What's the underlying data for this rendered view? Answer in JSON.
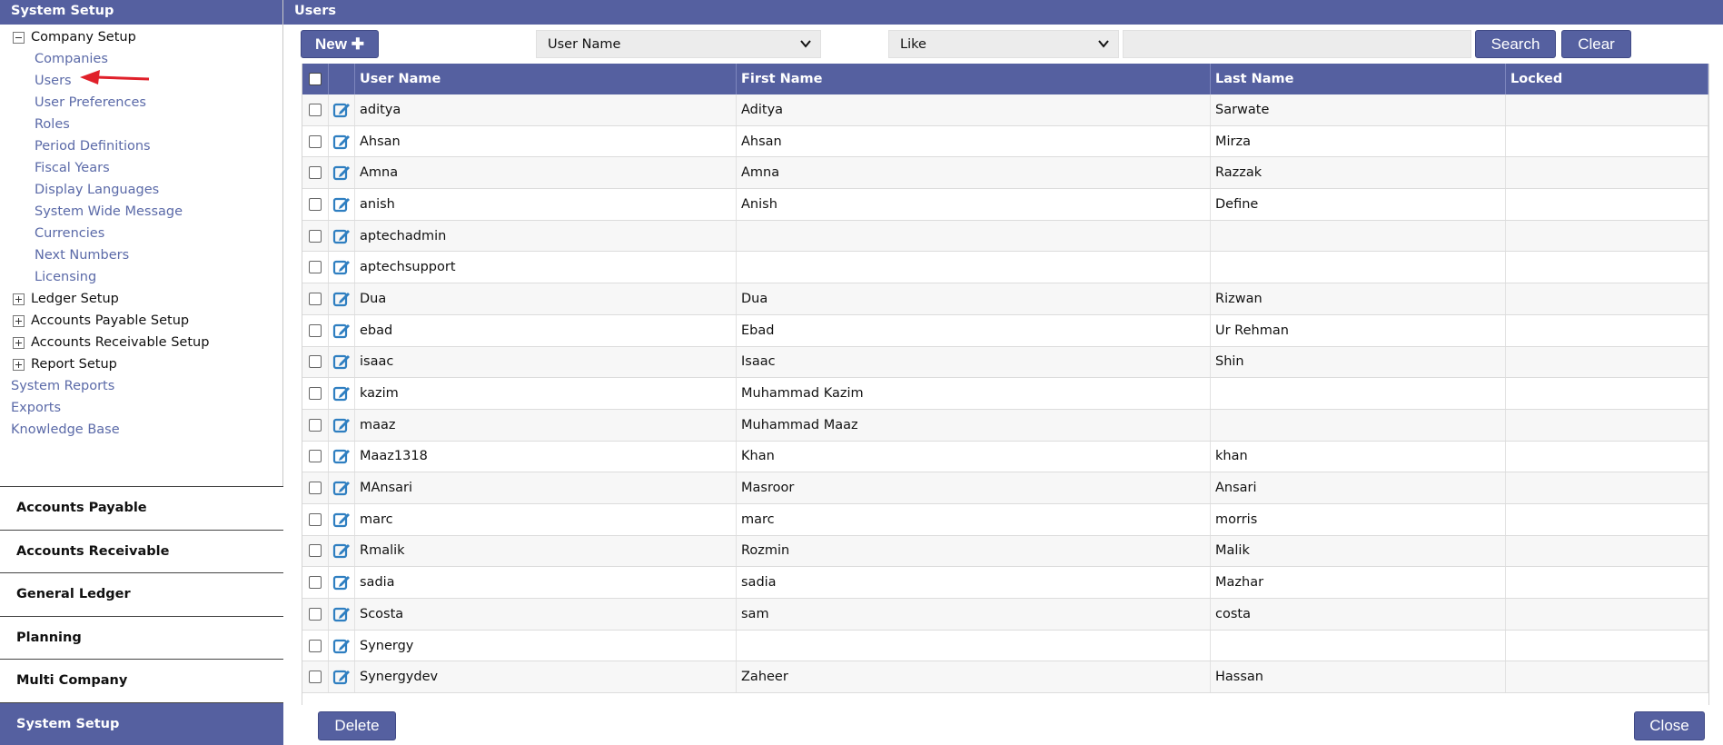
{
  "sidebar": {
    "title": "System Setup",
    "company_setup_label": "Company Setup",
    "company_setup_children": [
      "Companies",
      "Users",
      "User Preferences",
      "Roles",
      "Period Definitions",
      "Fiscal Years",
      "Display Languages",
      "System Wide Message",
      "Currencies",
      "Next Numbers",
      "Licensing"
    ],
    "collapsed_sections": [
      "Ledger Setup",
      "Accounts Payable Setup",
      "Accounts Receivable Setup",
      "Report Setup"
    ],
    "plain_links": [
      "System Reports",
      "Exports",
      "Knowledge Base"
    ],
    "modules": [
      "Accounts Payable",
      "Accounts Receivable",
      "General Ledger",
      "Planning",
      "Multi Company",
      "System Setup"
    ],
    "active_module": "System Setup"
  },
  "main": {
    "title": "Users",
    "new_label": "New ✚",
    "search_field": "User Name",
    "search_operator": "Like",
    "search_value": "",
    "search_label": "Search",
    "clear_label": "Clear",
    "delete_label": "Delete",
    "close_label": "Close"
  },
  "grid": {
    "columns": [
      "User Name",
      "First Name",
      "Last Name",
      "Locked"
    ],
    "rows": [
      {
        "user": "aditya",
        "first": "Aditya",
        "last": "Sarwate",
        "locked": ""
      },
      {
        "user": "Ahsan",
        "first": "Ahsan",
        "last": "Mirza",
        "locked": ""
      },
      {
        "user": "Amna",
        "first": "Amna",
        "last": "Razzak",
        "locked": ""
      },
      {
        "user": "anish",
        "first": "Anish",
        "last": "Define",
        "locked": ""
      },
      {
        "user": "aptechadmin",
        "first": "",
        "last": "",
        "locked": ""
      },
      {
        "user": "aptechsupport",
        "first": "",
        "last": "",
        "locked": ""
      },
      {
        "user": "Dua",
        "first": "Dua",
        "last": "Rizwan",
        "locked": ""
      },
      {
        "user": "ebad",
        "first": "Ebad",
        "last": "Ur Rehman",
        "locked": ""
      },
      {
        "user": "isaac",
        "first": "Isaac",
        "last": "Shin",
        "locked": ""
      },
      {
        "user": "kazim",
        "first": "Muhammad Kazim",
        "last": "",
        "locked": ""
      },
      {
        "user": "maaz",
        "first": "Muhammad Maaz",
        "last": "",
        "locked": ""
      },
      {
        "user": "Maaz1318",
        "first": "Khan",
        "last": "khan",
        "locked": ""
      },
      {
        "user": "MAnsari",
        "first": "Masroor",
        "last": "Ansari",
        "locked": ""
      },
      {
        "user": "marc",
        "first": "marc",
        "last": "morris",
        "locked": ""
      },
      {
        "user": "Rmalik",
        "first": "Rozmin",
        "last": "Malik",
        "locked": ""
      },
      {
        "user": "sadia",
        "first": "sadia",
        "last": "Mazhar",
        "locked": ""
      },
      {
        "user": "Scosta",
        "first": "sam",
        "last": "costa",
        "locked": ""
      },
      {
        "user": "Synergy",
        "first": "",
        "last": "",
        "locked": ""
      },
      {
        "user": "Synergydev",
        "first": "Zaheer",
        "last": "Hassan",
        "locked": ""
      }
    ]
  },
  "colors": {
    "accent": "#5560a0",
    "link": "#5b6aa8",
    "edit_icon": "#2f7fc1",
    "arrow": "#e0202a"
  },
  "icons": {
    "tree_expanded": "minus-box-icon",
    "tree_collapsed": "plus-box-icon",
    "row_edit": "edit-pencil-icon",
    "dropdown": "chevron-down-icon",
    "annotation": "red-arrow-icon"
  }
}
